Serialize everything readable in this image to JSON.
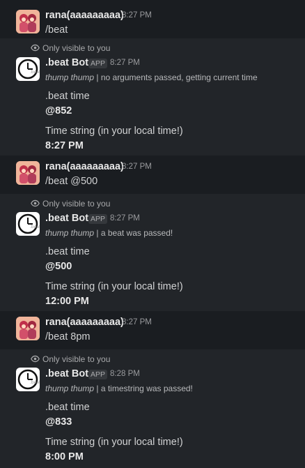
{
  "messages": [
    {
      "user": "rana(aaaaaaaaa)",
      "time": "8:27 PM",
      "command": "/beat"
    },
    {
      "user": "rana(aaaaaaaaa)",
      "time": "8:27 PM",
      "command": "/beat @500"
    },
    {
      "user": "rana(aaaaaaaaa)",
      "time": "8:27 PM",
      "command": "/beat 8pm"
    }
  ],
  "replies": [
    {
      "visibility": "Only visible to you",
      "bot_name": ".beat Bot",
      "app_badge": "APP",
      "time": "8:27 PM",
      "note_italic": "thump thump",
      "note_text": " | no arguments passed, getting current time",
      "beat_label": ".beat time",
      "beat_value": "@852",
      "string_label": "Time string (in your local time!)",
      "string_value": "8:27 PM"
    },
    {
      "visibility": "Only visible to you",
      "bot_name": ".beat Bot",
      "app_badge": "APP",
      "time": "8:27 PM",
      "note_italic": "thump thump",
      "note_text": " | a beat was passed!",
      "beat_label": ".beat time",
      "beat_value": "@500",
      "string_label": "Time string (in your local time!)",
      "string_value": "12:00 PM"
    },
    {
      "visibility": "Only visible to you",
      "bot_name": ".beat Bot",
      "app_badge": "APP",
      "time": "8:28 PM",
      "note_italic": "thump thump",
      "note_text": " | a timestring was passed!",
      "beat_label": ".beat time",
      "beat_value": "@833",
      "string_label": "Time string (in your local time!)",
      "string_value": "8:00 PM"
    }
  ],
  "icons": {
    "eye": "eye-icon",
    "clock": "clock-icon"
  },
  "colors": {
    "background": "#1a1d21",
    "bot_background": "#222529",
    "text": "#d1d2d3"
  }
}
